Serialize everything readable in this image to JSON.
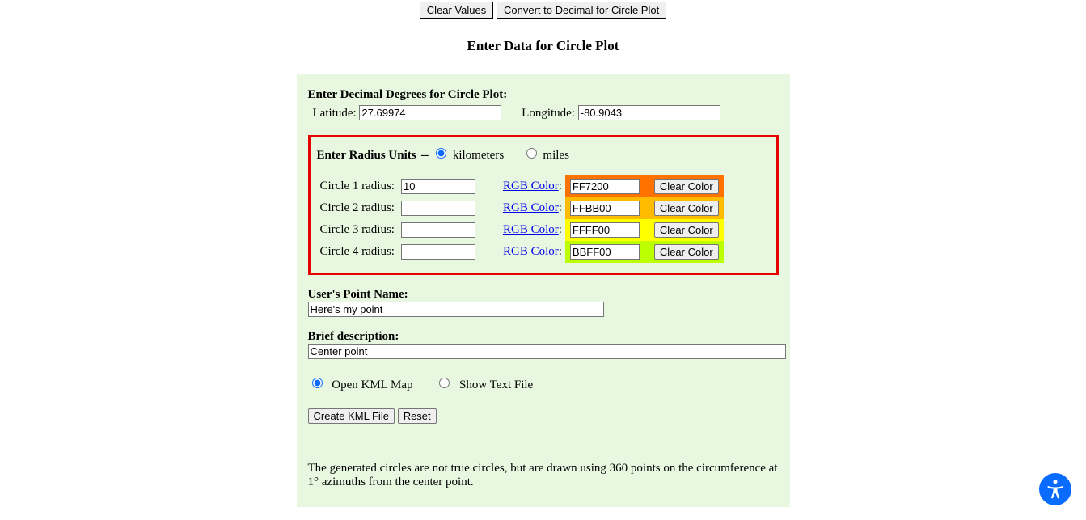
{
  "topButtons": {
    "clearValues": "Clear Values",
    "convert": "Convert to Decimal for Circle Plot"
  },
  "heading": "Enter Data for Circle Plot",
  "coords": {
    "sectionLabel": "Enter Decimal Degrees for Circle Plot:",
    "latLabel": "Latitude:",
    "latValue": "27.69974",
    "lonLabel": "Longitude:",
    "lonValue": "-80.9043"
  },
  "units": {
    "label": "Enter Radius Units",
    "dash": " -- ",
    "km": "kilometers",
    "miles": "miles"
  },
  "rgbLinkText": "RGB Color",
  "clearColorLabel": "Clear Color",
  "circles": [
    {
      "label": "Circle 1 radius:",
      "radius": "10",
      "color": "FF7200",
      "bg": "#ff7200"
    },
    {
      "label": "Circle 2 radius:",
      "radius": "",
      "color": "FFBB00",
      "bg": "#ffbb00"
    },
    {
      "label": "Circle 3 radius:",
      "radius": "",
      "color": "FFFF00",
      "bg": "#ffff00"
    },
    {
      "label": "Circle 4 radius:",
      "radius": "",
      "color": "BBFF00",
      "bg": "#bbff00"
    }
  ],
  "pointName": {
    "label": "User's Point Name:",
    "value": "Here's my point"
  },
  "description": {
    "label": "Brief description:",
    "value": "Center point"
  },
  "output": {
    "openKml": "Open KML Map",
    "showText": "Show Text File"
  },
  "actions": {
    "create": "Create KML File",
    "reset": "Reset"
  },
  "note": "The generated circles are not true circles, but are drawn using 360 points on the circumference at 1° azimuths from the center point."
}
